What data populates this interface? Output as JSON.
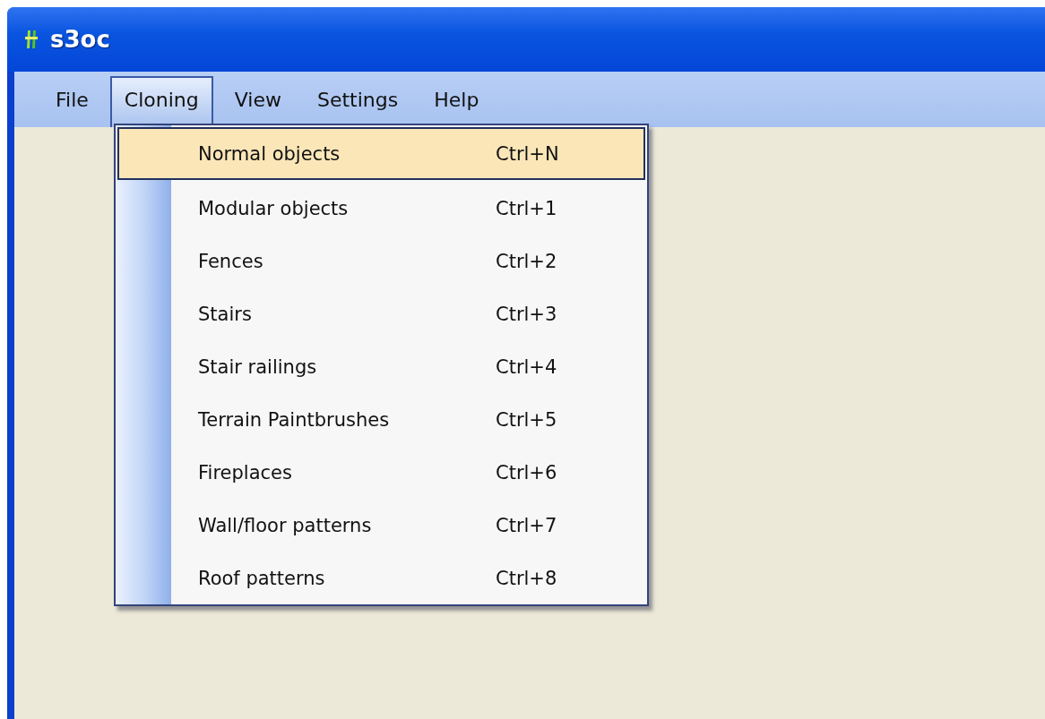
{
  "window": {
    "title": "s3oc"
  },
  "menu_bar": [
    {
      "label": "File",
      "selected": false
    },
    {
      "label": "Cloning",
      "selected": true
    },
    {
      "label": "View",
      "selected": false
    },
    {
      "label": "Settings",
      "selected": false
    },
    {
      "label": "Help",
      "selected": false
    }
  ],
  "dropdown": [
    {
      "label": "Normal objects",
      "shortcut": "Ctrl+N",
      "selected": true
    },
    {
      "label": "Modular objects",
      "shortcut": "Ctrl+1",
      "selected": false
    },
    {
      "label": "Fences",
      "shortcut": "Ctrl+2",
      "selected": false
    },
    {
      "label": "Stairs",
      "shortcut": "Ctrl+3",
      "selected": false
    },
    {
      "label": "Stair railings",
      "shortcut": "Ctrl+4",
      "selected": false
    },
    {
      "label": "Terrain Paintbrushes",
      "shortcut": "Ctrl+5",
      "selected": false
    },
    {
      "label": "Fireplaces",
      "shortcut": "Ctrl+6",
      "selected": false
    },
    {
      "label": "Wall/floor patterns",
      "shortcut": "Ctrl+7",
      "selected": false
    },
    {
      "label": "Roof patterns",
      "shortcut": "Ctrl+8",
      "selected": false
    }
  ]
}
